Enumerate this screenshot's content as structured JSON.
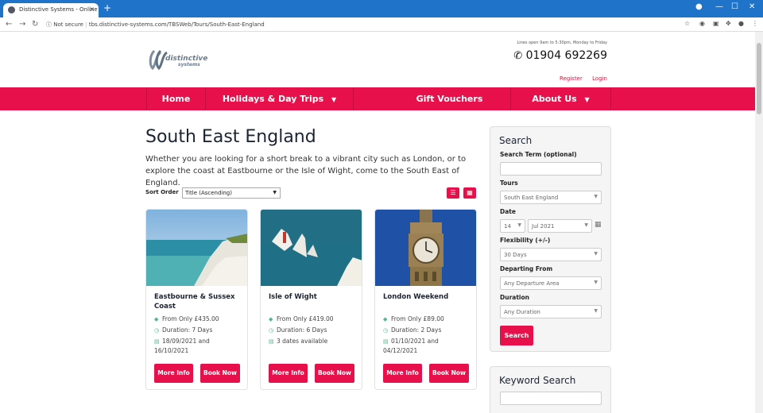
{
  "browser": {
    "tab_title": "Distinctive Systems - Online book",
    "tab_close": "×",
    "new_tab": "+",
    "security": "Not secure",
    "url": "tbs.distinctive-systems.com/TBSWeb/Tours/South-East-England"
  },
  "header": {
    "logo_name": "distinctive",
    "logo_sub": "systems",
    "hours": "Lines open 9am to 5:30pm, Monday to Friday",
    "phone": "01904 692269",
    "register": "Register",
    "login": "Login"
  },
  "nav": {
    "home": "Home",
    "holidays": "Holidays & Day Trips",
    "gift": "Gift Vouchers",
    "about": "About Us"
  },
  "main": {
    "title": "South East England",
    "intro": "Whether you are looking for a short break to a vibrant city such as London, or to explore the coast at Eastbourne or the Isle of Wight, come to the South East of England.",
    "sort_label": "Sort Order",
    "sort_value": "Title (Ascending)"
  },
  "cards": [
    {
      "title": "Eastbourne & Sussex Coast",
      "price": "From Only £435.00",
      "duration": "Duration: 7 Days",
      "dates": "18/09/2021 and 16/10/2021",
      "more": "More Info",
      "book": "Book Now"
    },
    {
      "title": "Isle of Wight",
      "price": "From Only £419.00",
      "duration": "Duration: 6 Days",
      "dates": "3 dates available",
      "more": "More Info",
      "book": "Book Now"
    },
    {
      "title": "London Weekend",
      "price": "From Only £89.00",
      "duration": "Duration: 2 Days",
      "dates": "01/10/2021 and 04/12/2021",
      "more": "More Info",
      "book": "Book Now"
    }
  ],
  "search": {
    "title": "Search",
    "term_label": "Search Term (optional)",
    "tours_label": "Tours",
    "tours_value": "South East England",
    "date_label": "Date",
    "day_value": "14",
    "month_value": "Jul 2021",
    "flex_label": "Flexibility (+/-)",
    "flex_value": "30 Days",
    "departing_label": "Departing From",
    "departing_value": "Any Departure Area",
    "duration_label": "Duration",
    "duration_value": "Any Duration",
    "button": "Search"
  },
  "keyword": {
    "title": "Keyword Search"
  },
  "colors": {
    "brand": "#e8104a",
    "chrome": "#1f73c8"
  }
}
